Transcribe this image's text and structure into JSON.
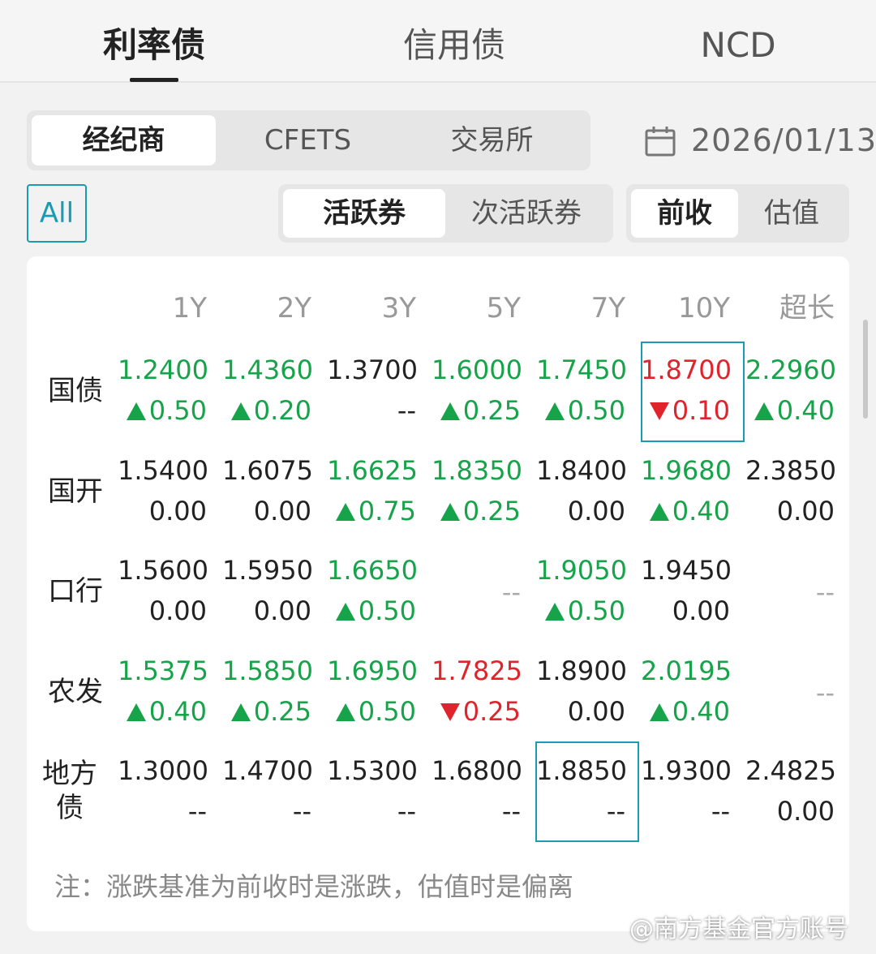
{
  "top_tabs": [
    "利率债",
    "信用债",
    "NCD"
  ],
  "source_tabs": [
    "经纪商",
    "CFETS",
    "交易所"
  ],
  "date": "2026/01/13",
  "filter_all": "All",
  "bond_tabs": [
    "活跃券",
    "次活跃券"
  ],
  "price_tabs": [
    "前收",
    "估值"
  ],
  "columns": [
    "1Y",
    "2Y",
    "3Y",
    "5Y",
    "7Y",
    "10Y",
    "超长"
  ],
  "rows": [
    {
      "label": "国债",
      "cells": [
        {
          "v": "1.2400",
          "c": "0.50",
          "dir": "up"
        },
        {
          "v": "1.4360",
          "c": "0.20",
          "dir": "up"
        },
        {
          "v": "1.3700",
          "c": "--",
          "dir": "none"
        },
        {
          "v": "1.6000",
          "c": "0.25",
          "dir": "up"
        },
        {
          "v": "1.7450",
          "c": "0.50",
          "dir": "up"
        },
        {
          "v": "1.8700",
          "c": "0.10",
          "dir": "down"
        },
        {
          "v": "2.2960",
          "c": "0.40",
          "dir": "up"
        }
      ]
    },
    {
      "label": "国开",
      "cells": [
        {
          "v": "1.5400",
          "c": "0.00",
          "dir": "flat"
        },
        {
          "v": "1.6075",
          "c": "0.00",
          "dir": "flat"
        },
        {
          "v": "1.6625",
          "c": "0.75",
          "dir": "up"
        },
        {
          "v": "1.8350",
          "c": "0.25",
          "dir": "up"
        },
        {
          "v": "1.8400",
          "c": "0.00",
          "dir": "flat"
        },
        {
          "v": "1.9680",
          "c": "0.40",
          "dir": "up"
        },
        {
          "v": "2.3850",
          "c": "0.00",
          "dir": "flat"
        }
      ]
    },
    {
      "label": "口行",
      "cells": [
        {
          "v": "1.5600",
          "c": "0.00",
          "dir": "flat"
        },
        {
          "v": "1.5950",
          "c": "0.00",
          "dir": "flat"
        },
        {
          "v": "1.6650",
          "c": "0.50",
          "dir": "up"
        },
        {
          "v": "--",
          "c": "",
          "dir": "empty"
        },
        {
          "v": "1.9050",
          "c": "0.50",
          "dir": "up"
        },
        {
          "v": "1.9450",
          "c": "0.00",
          "dir": "flat"
        },
        {
          "v": "--",
          "c": "",
          "dir": "empty"
        }
      ]
    },
    {
      "label": "农发",
      "cells": [
        {
          "v": "1.5375",
          "c": "0.40",
          "dir": "up"
        },
        {
          "v": "1.5850",
          "c": "0.25",
          "dir": "up"
        },
        {
          "v": "1.6950",
          "c": "0.50",
          "dir": "up"
        },
        {
          "v": "1.7825",
          "c": "0.25",
          "dir": "down"
        },
        {
          "v": "1.8900",
          "c": "0.00",
          "dir": "flat"
        },
        {
          "v": "2.0195",
          "c": "0.40",
          "dir": "up"
        },
        {
          "v": "--",
          "c": "",
          "dir": "empty"
        }
      ]
    },
    {
      "label": "地方债",
      "cells": [
        {
          "v": "1.3000",
          "c": "--",
          "dir": "none"
        },
        {
          "v": "1.4700",
          "c": "--",
          "dir": "none"
        },
        {
          "v": "1.5300",
          "c": "--",
          "dir": "none"
        },
        {
          "v": "1.6800",
          "c": "--",
          "dir": "none"
        },
        {
          "v": "1.8850",
          "c": "--",
          "dir": "none"
        },
        {
          "v": "1.9300",
          "c": "--",
          "dir": "none"
        },
        {
          "v": "2.4825",
          "c": "0.00",
          "dir": "flat"
        }
      ]
    }
  ],
  "note": "注：涨跌基准为前收时是涨跌，估值时是偏离",
  "watermark": "@南方基金官方账号",
  "colors": {
    "up": "#17a34a",
    "down": "#e0242c",
    "accent": "#1a9ab3"
  }
}
